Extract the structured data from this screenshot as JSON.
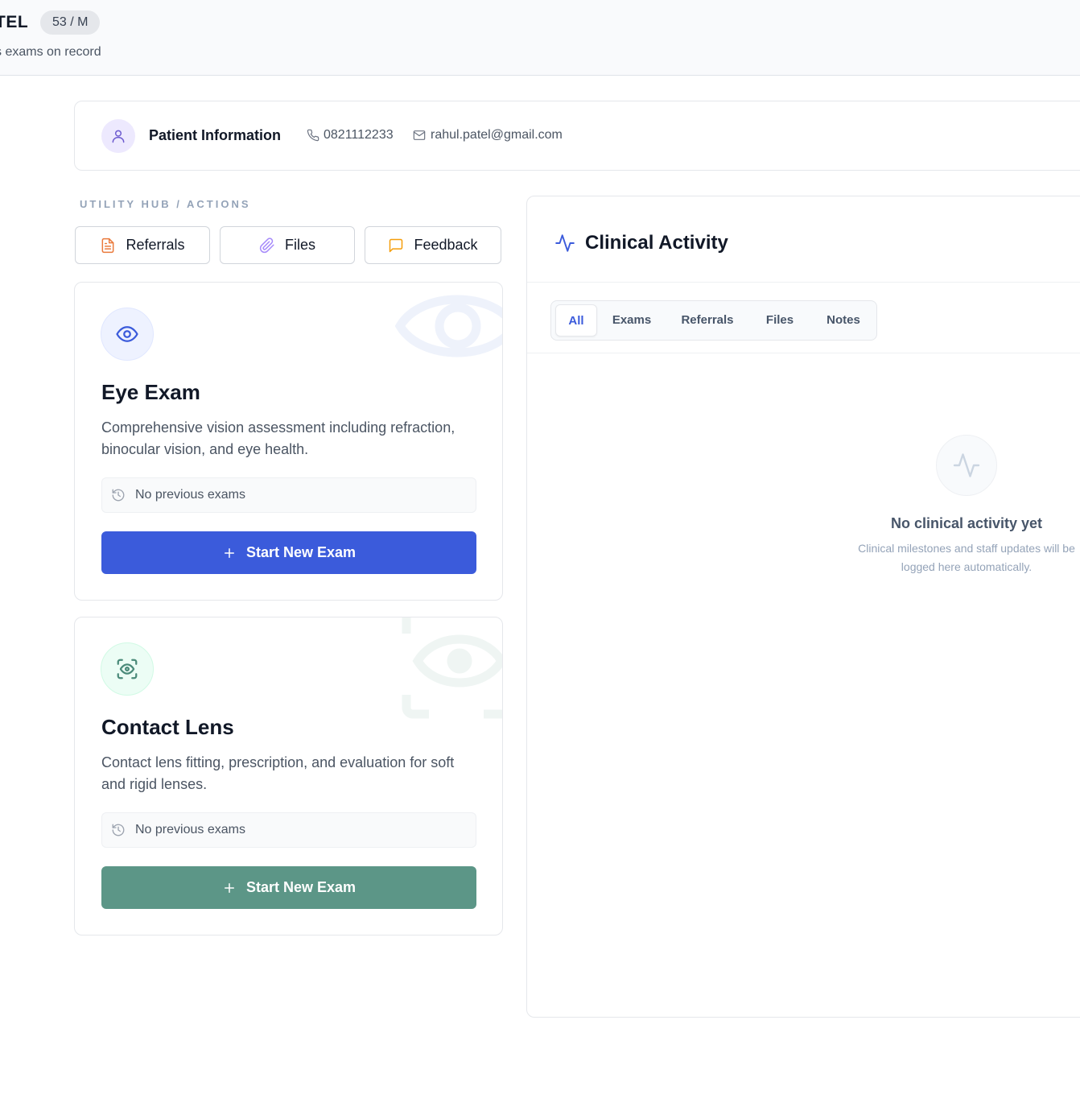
{
  "header": {
    "patient_name": "TEL",
    "age_sex": "53 / M",
    "exam_count": "s exams on record"
  },
  "patient_info": {
    "title": "Patient Information",
    "phone": "0821112233",
    "email": "rahul.patel@gmail.com"
  },
  "utility_hub": {
    "label": "UTILITY HUB / ACTIONS",
    "buttons": [
      {
        "label": "Referrals",
        "icon": "file-text-icon",
        "color": "#ea7a3c"
      },
      {
        "label": "Files",
        "icon": "paperclip-icon",
        "color": "#a78bfa"
      },
      {
        "label": "Feedback",
        "icon": "message-square-icon",
        "color": "#f59e0b"
      }
    ]
  },
  "services": [
    {
      "title": "Eye Exam",
      "description": "Comprehensive vision assessment including refraction, binocular vision, and eye health.",
      "previous": "No previous exams",
      "button": "Start New Exam",
      "icon": "eye-icon",
      "accent": "#3b5bdb",
      "icon_bg": "#eef2ff"
    },
    {
      "title": "Contact Lens",
      "description": "Contact lens fitting, prescription, and evaluation for soft and rigid lenses.",
      "previous": "No previous exams",
      "button": "Start New Exam",
      "icon": "scan-eye-icon",
      "accent": "#5c9687",
      "icon_bg": "#ecfdf5"
    }
  ],
  "activity": {
    "title": "Clinical Activity",
    "tabs": [
      {
        "label": "All",
        "active": true
      },
      {
        "label": "Exams",
        "active": false
      },
      {
        "label": "Referrals",
        "active": false
      },
      {
        "label": "Files",
        "active": false
      },
      {
        "label": "Notes",
        "active": false
      }
    ],
    "empty_title": "No clinical activity yet",
    "empty_subtitle": "Clinical milestones and staff updates will be logged here automatically."
  }
}
